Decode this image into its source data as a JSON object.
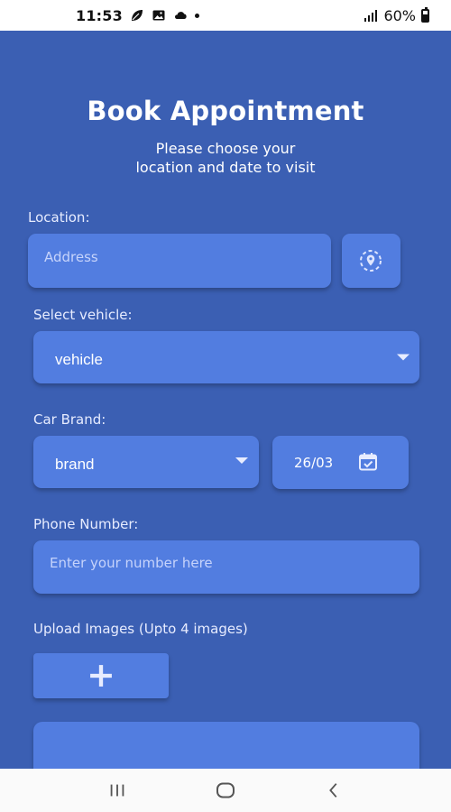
{
  "status": {
    "time": "11:53",
    "battery": "60%"
  },
  "page": {
    "title": "Book Appointment",
    "subtitle_line1": "Please choose your",
    "subtitle_line2": "location and date to visit"
  },
  "form": {
    "location_label": "Location:",
    "address_placeholder": "Address",
    "vehicle_label": "Select vehicle:",
    "vehicle_value": "vehicle",
    "brand_label": "Car Brand:",
    "brand_value": "brand",
    "date_value": "26/03",
    "phone_label": "Phone Number:",
    "phone_placeholder": "Enter your number here",
    "upload_label": "Upload Images (Upto 4 images)"
  },
  "colors": {
    "background": "#3b5fb3",
    "field": "#527de0"
  },
  "icons": {
    "location": "location-pin-icon",
    "calendar": "calendar-icon",
    "add": "plus-icon"
  }
}
